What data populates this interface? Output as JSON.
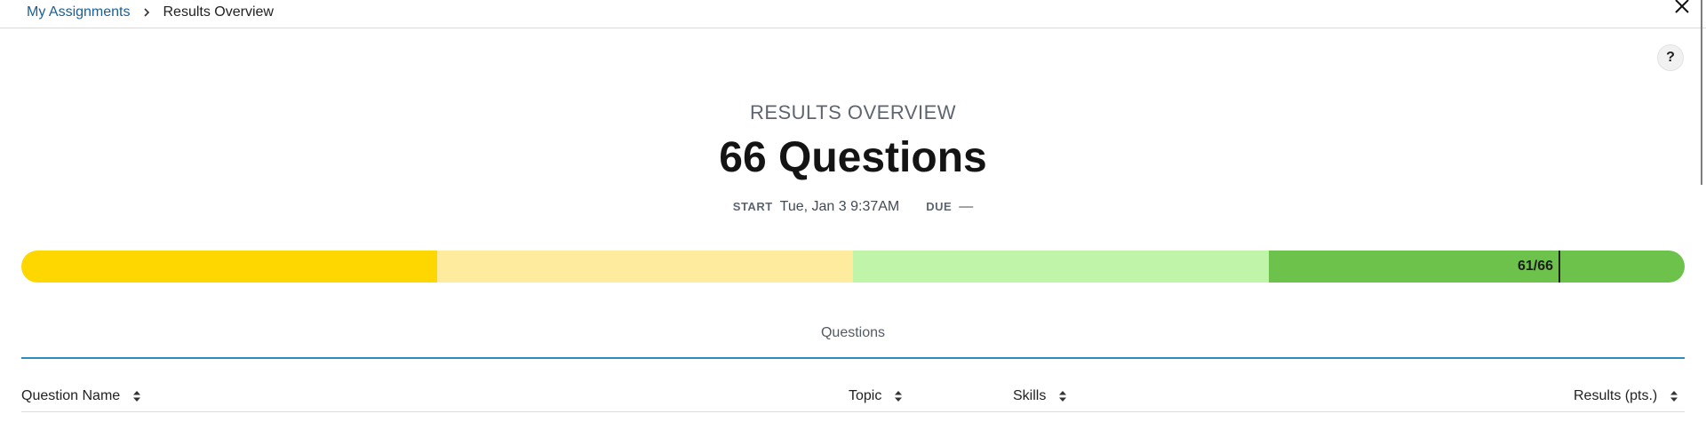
{
  "breadcrumb": {
    "link_label": "My Assignments",
    "current_label": "Results Overview"
  },
  "icons": {
    "separator": "chevron-right-icon",
    "close": "close-icon",
    "help": "help-icon",
    "sort": "sort-icon"
  },
  "help_button_label": "?",
  "overview": {
    "label": "RESULTS OVERVIEW",
    "title": "66 Questions",
    "start_key": "START",
    "start_value": "Tue, Jan 3 9:37AM",
    "due_key": "DUE",
    "due_value": "—"
  },
  "progress": {
    "score_label": "61/66",
    "marker_fraction": 0.924,
    "segments": [
      {
        "color": "#fed700"
      },
      {
        "color": "#feeb9e"
      },
      {
        "color": "#bff4a9"
      },
      {
        "color": "#6cc24a"
      }
    ]
  },
  "tabs": [
    {
      "label": "Questions"
    }
  ],
  "table": {
    "columns": [
      {
        "label": "Question Name"
      },
      {
        "label": "Topic"
      },
      {
        "label": "Skills"
      },
      {
        "label": "Results (pts.)"
      }
    ]
  }
}
